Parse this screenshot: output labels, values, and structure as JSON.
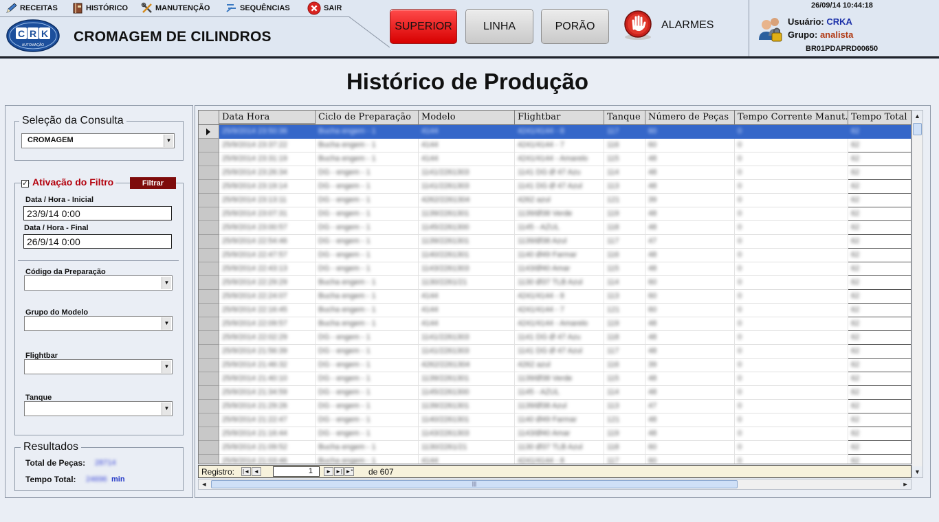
{
  "menu": {
    "receitas": "RECEITAS",
    "historico": "HISTÓRICO",
    "manutencao": "MANUTENÇÃO",
    "sequencias": "SEQUÊNCIAS",
    "sair": "SAIR"
  },
  "app": {
    "title": "CROMAGEM DE CILINDROS",
    "logo_text": "CRK",
    "logo_sub": "AUTOMAÇÃO"
  },
  "nav": {
    "superior": "SUPERIOR",
    "linha": "LINHA",
    "porao": "PORÃO",
    "alarmes": "ALARMES"
  },
  "user": {
    "datetime": "26/09/14 10:44:18",
    "user_label": "Usuário:",
    "user_value": "CRKA",
    "group_label": "Grupo:",
    "group_value": "analista",
    "station": "BR01PDAPRD00650"
  },
  "page": {
    "title": "Histórico de Produção"
  },
  "colors": {
    "accent_red": "#e81b1b",
    "selection_blue": "#3567c9",
    "filter_btn": "#7e0b0b"
  },
  "query": {
    "legend": "Seleção da Consulta",
    "selected": "CROMAGEM"
  },
  "filter": {
    "legend": "Ativação do Filtro",
    "checked": "✓",
    "button": "Filtrar",
    "start_label": "Data / Hora - Inicial",
    "start_value": "23/9/14 0:00",
    "end_label": "Data / Hora - Final",
    "end_value": "26/9/14 0:00",
    "prep_label": "Código da Preparação",
    "group_label": "Grupo do Modelo",
    "flightbar_label": "Flightbar",
    "tank_label": "Tanque"
  },
  "results": {
    "legend": "Resultados",
    "total_label": "Total de Peças:",
    "total_value": "28714",
    "time_label": "Tempo Total:",
    "time_value": "24696",
    "time_unit": "min"
  },
  "grid": {
    "columns": [
      "Data Hora",
      "Ciclo de Preparação",
      "Modelo",
      "Flightbar",
      "Tanque",
      "Número de Peças",
      "Tempo Corrente Manut.",
      "Tempo Total"
    ],
    "rows": [
      [
        "25/9/2014 23:50:36",
        "Bucha engem - 1",
        "4144",
        "4241/4144 - 8",
        "117",
        "60",
        "0",
        "62"
      ],
      [
        "25/9/2014 23:37:22",
        "Bucha engem - 1",
        "4144",
        "4241/4144 - 7",
        "116",
        "60",
        "0",
        "62"
      ],
      [
        "25/9/2014 23:31:19",
        "Bucha engem - 1",
        "4144",
        "4241/4144 - Amarelo",
        "115",
        "48",
        "0",
        "62"
      ],
      [
        "25/9/2014 23:26:34",
        "DG - engem - 1",
        "1141/2261303",
        "1141 DG Ø 47 Azu",
        "114",
        "48",
        "0",
        "62"
      ],
      [
        "25/9/2014 23:19:14",
        "DG - engem - 1",
        "1141/2261303",
        "1141 DG Ø 47 Azul",
        "113",
        "48",
        "0",
        "62"
      ],
      [
        "25/9/2014 23:13:11",
        "DG - engem - 1",
        "4262/2261304",
        "4262 azul",
        "121",
        "39",
        "0",
        "62"
      ],
      [
        "25/9/2014 23:07:31",
        "DG - engem - 1",
        "1139/2261301",
        "1139/Ø38 Verde",
        "119",
        "48",
        "0",
        "62"
      ],
      [
        "25/9/2014 23:00:57",
        "DG - engem - 1",
        "1145/2261300",
        "1145 - AZUL",
        "118",
        "48",
        "0",
        "62"
      ],
      [
        "25/9/2014 22:54:46",
        "DG - engem - 1",
        "1139/2261301",
        "1139/Ø38 Azul",
        "117",
        "47",
        "0",
        "62"
      ],
      [
        "25/9/2014 22:47:57",
        "DG - engem - 1",
        "1140/2261301",
        "1140 Ø49 Farmar",
        "116",
        "48",
        "0",
        "62"
      ],
      [
        "25/9/2014 22:43:13",
        "DG - engem - 1",
        "1143/2261303",
        "1143/Ø40 Amar",
        "115",
        "48",
        "0",
        "62"
      ],
      [
        "25/9/2014 22:29:29",
        "Bucha engem - 1",
        "1130/2261/21",
        "1130 Ø37 TLB Azul",
        "114",
        "60",
        "0",
        "62"
      ],
      [
        "25/9/2014 22:24:07",
        "Bucha engem - 1",
        "4144",
        "4241/4144 - 8",
        "113",
        "60",
        "0",
        "62"
      ],
      [
        "25/9/2014 22:16:45",
        "Bucha engem - 1",
        "4144",
        "4241/4144 - 7",
        "121",
        "60",
        "0",
        "62"
      ],
      [
        "25/9/2014 22:09:57",
        "Bucha engem - 1",
        "4144",
        "4241/4144 - Amarelo",
        "119",
        "48",
        "0",
        "62"
      ],
      [
        "25/9/2014 22:02:29",
        "DG - engem - 1",
        "1141/2261303",
        "1141 DG Ø 47 Azu",
        "118",
        "48",
        "0",
        "62"
      ],
      [
        "25/9/2014 21:56:39",
        "DG - engem - 1",
        "1141/2261303",
        "1141 DG Ø 47 Azul",
        "117",
        "48",
        "0",
        "62"
      ],
      [
        "25/9/2014 21:46:32",
        "DG - engem - 1",
        "4262/2261304",
        "4262 azul",
        "116",
        "39",
        "0",
        "62"
      ],
      [
        "25/9/2014 21:40:10",
        "DG - engem - 1",
        "1139/2261301",
        "1139/Ø38 Verde",
        "115",
        "48",
        "0",
        "62"
      ],
      [
        "25/9/2014 21:34:59",
        "DG - engem - 1",
        "1145/2261300",
        "1145 - AZUL",
        "114",
        "48",
        "0",
        "62"
      ],
      [
        "25/9/2014 21:29:26",
        "DG - engem - 1",
        "1139/2261301",
        "1139/Ø38 Azul",
        "113",
        "47",
        "0",
        "62"
      ],
      [
        "25/9/2014 21:22:47",
        "DG - engem - 1",
        "1140/2261301",
        "1140 Ø49 Farmar",
        "121",
        "48",
        "0",
        "62"
      ],
      [
        "25/9/2014 21:16:44",
        "DG - engem - 1",
        "1143/2261303",
        "1143/Ø40 Amar",
        "119",
        "48",
        "0",
        "62"
      ],
      [
        "25/9/2014 21:09:52",
        "Bucha engem - 1",
        "1130/2261/21",
        "1130 Ø37 TLB Azul",
        "118",
        "60",
        "0",
        "62"
      ],
      [
        "25/9/2014 21:03:46",
        "Bucha engem - 1",
        "4144",
        "4241/4144 - 8",
        "117",
        "60",
        "0",
        "62"
      ]
    ]
  },
  "navigator": {
    "label": "Registro:",
    "current": "1",
    "of": "de 607",
    "first": "|◄",
    "prev": "◄",
    "next": "►",
    "last": "►|",
    "new": "►*"
  },
  "icons": {
    "receitas": "pencil-icon",
    "historico": "book-icon",
    "manutencao": "tools-icon",
    "sequencias": "sequence-icon",
    "sair": "exit-icon",
    "alarm": "stop-hand-icon",
    "users": "users-lock-icon"
  }
}
